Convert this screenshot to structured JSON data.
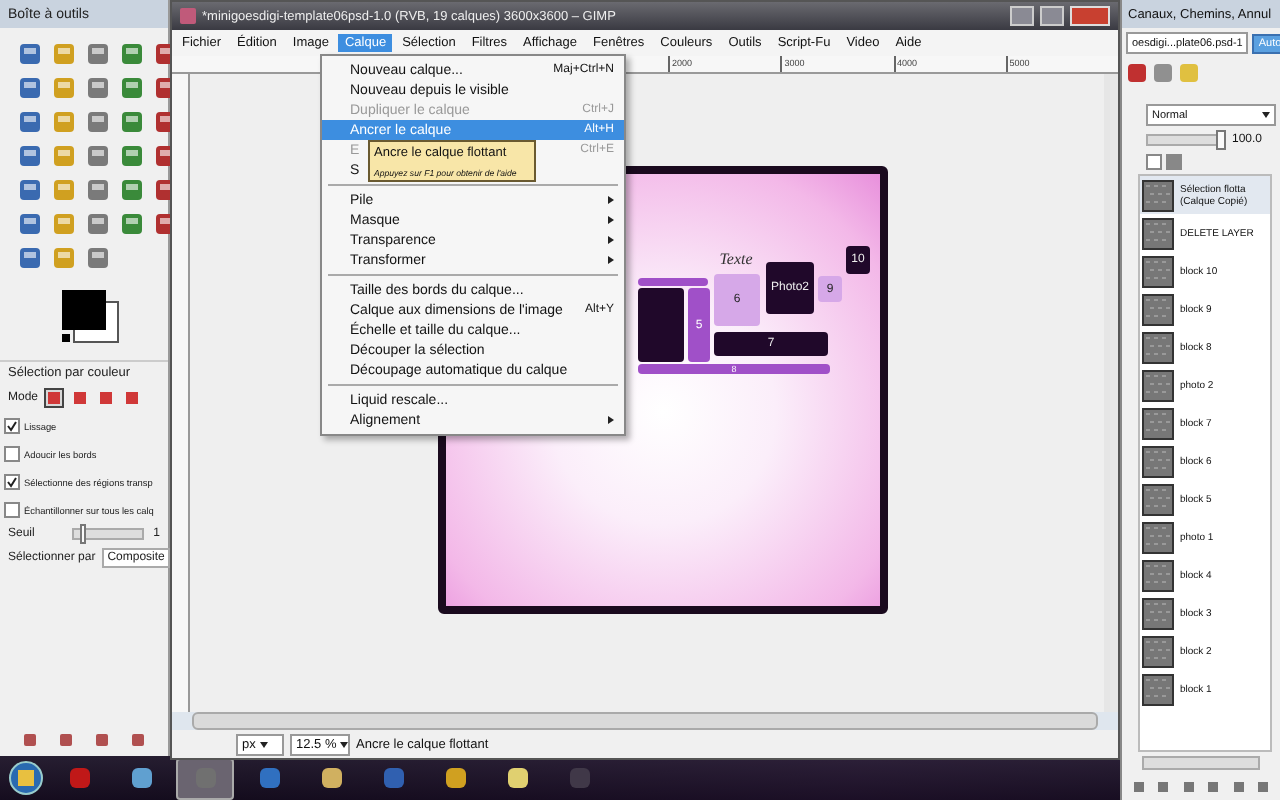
{
  "toolbox": {
    "title": "Boîte à outils",
    "tool_options": {
      "title": "Sélection par couleur",
      "mode_label": "Mode",
      "modes": [
        {
          "selected": true
        },
        {
          "selected": false
        },
        {
          "selected": false
        },
        {
          "selected": false
        }
      ],
      "options": [
        {
          "label": "Lissage",
          "checked": true
        },
        {
          "label": "Adoucir les bords",
          "checked": false
        },
        {
          "label": "Sélectionne des régions transp",
          "checked": true
        },
        {
          "label": "Échantillonner sur tous les calq",
          "checked": false
        }
      ],
      "threshold": {
        "label": "Seuil",
        "level": 0.1,
        "value": "1"
      },
      "select_by": {
        "label": "Sélectionner par",
        "value": "Composite"
      }
    }
  },
  "main_window": {
    "title": "*minigoesdigi-template06psd-1.0 (RVB, 19 calques) 3600x3600 – GIMP",
    "menu": [
      {
        "label": "Fichier",
        "selected": false
      },
      {
        "label": "Édition",
        "selected": false
      },
      {
        "label": "Image",
        "selected": false
      },
      {
        "label": "Calque",
        "selected": true
      },
      {
        "label": "Sélection",
        "selected": false
      },
      {
        "label": "Filtres",
        "selected": false
      },
      {
        "label": "Affichage",
        "selected": false
      },
      {
        "label": "Fenêtres",
        "selected": false
      },
      {
        "label": "Couleurs",
        "selected": false
      },
      {
        "label": "Outils",
        "selected": false
      },
      {
        "label": "Script-Fu",
        "selected": false
      },
      {
        "label": "Video",
        "selected": false
      },
      {
        "label": "Aide",
        "selected": false
      }
    ],
    "ruler_labels": [
      "2000",
      "3000",
      "4000",
      "5000"
    ],
    "canvas_blocks": [
      {
        "label": "Texte",
        "kind": "script"
      },
      {
        "label": "5",
        "kind": "mid"
      },
      {
        "label": "6",
        "kind": "light"
      },
      {
        "label": "Photo2",
        "kind": "dark"
      },
      {
        "label": "9",
        "kind": "light"
      },
      {
        "label": "10",
        "kind": "dark"
      },
      {
        "label": "7",
        "kind": "dark"
      },
      {
        "label": "8",
        "kind": "mid"
      }
    ],
    "status_bar": {
      "unit": "px",
      "zoom": "12.5 %",
      "message": "Ancre le calque flottant"
    }
  },
  "layer_menu": {
    "items": [
      {
        "kind": "item",
        "label": "Nouveau calque...",
        "shortcut": "Maj+Ctrl+N",
        "disabled": false,
        "selected": false
      },
      {
        "kind": "item",
        "label": "Nouveau depuis le visible",
        "disabled": false,
        "selected": false
      },
      {
        "kind": "item",
        "label": "Dupliquer le calque",
        "shortcut": "Ctrl+J",
        "disabled": true,
        "selected": false
      },
      {
        "kind": "item",
        "label": "Ancrer le calque",
        "shortcut": "Alt+H",
        "disabled": false,
        "selected": true
      },
      {
        "kind": "item",
        "label": "E",
        "shortcut": "Ctrl+E",
        "disabled": true,
        "selected": false
      },
      {
        "kind": "item",
        "label": "S",
        "disabled": false,
        "selected": false
      },
      {
        "kind": "separator"
      },
      {
        "kind": "submenu",
        "label": "Pile",
        "disabled": false,
        "selected": false
      },
      {
        "kind": "submenu",
        "label": "Masque",
        "disabled": false,
        "selected": false
      },
      {
        "kind": "submenu",
        "label": "Transparence",
        "disabled": false,
        "selected": false
      },
      {
        "kind": "submenu",
        "label": "Transformer",
        "disabled": false,
        "selected": false
      },
      {
        "kind": "separator"
      },
      {
        "kind": "item",
        "label": "Taille des bords du calque...",
        "disabled": false,
        "selected": false
      },
      {
        "kind": "item",
        "label": "Calque aux dimensions de l'image",
        "shortcut": "Alt+Y",
        "disabled": false,
        "selected": false
      },
      {
        "kind": "item",
        "label": "Échelle et taille du calque...",
        "disabled": false,
        "selected": false
      },
      {
        "kind": "item",
        "label": "Découper la sélection",
        "disabled": false,
        "selected": false
      },
      {
        "kind": "item",
        "label": "Découpage automatique du calque",
        "disabled": false,
        "selected": false
      },
      {
        "kind": "separator"
      },
      {
        "kind": "item",
        "label": "Liquid rescale...",
        "disabled": false,
        "selected": false
      },
      {
        "kind": "submenu",
        "label": "Alignement",
        "disabled": false,
        "selected": false
      }
    ],
    "tooltip": {
      "title": "Ancre le calque flottant",
      "hint": "Appuyez sur F1 pour obtenir de l'aide"
    }
  },
  "dock": {
    "title": "Canaux, Chemins, Annul",
    "image": "oesdigi...plate06.psd-1",
    "auto_button": "Auto",
    "mode": "Normal",
    "opacity": {
      "level": 1,
      "value": "100.0"
    },
    "lock_alpha": {
      "checked": false
    },
    "layers": [
      {
        "name": "Sélection flotta",
        "note": "(Calque Copié)",
        "selected": true
      },
      {
        "name": "DELETE LAYER",
        "selected": false
      },
      {
        "name": "block 10",
        "selected": false
      },
      {
        "name": "block 9",
        "selected": false
      },
      {
        "name": "block 8",
        "selected": false
      },
      {
        "name": "photo 2",
        "selected": false
      },
      {
        "name": "block 7",
        "selected": false
      },
      {
        "name": "block 6",
        "selected": false
      },
      {
        "name": "block 5",
        "selected": false
      },
      {
        "name": "photo 1",
        "selected": false
      },
      {
        "name": "block 4",
        "selected": false
      },
      {
        "name": "block 3",
        "selected": false
      },
      {
        "name": "block 2",
        "selected": false
      },
      {
        "name": "block 1",
        "selected": false
      }
    ]
  },
  "taskbar": {
    "apps": [
      {
        "selected": false
      },
      {
        "selected": false
      },
      {
        "selected": true
      },
      {
        "selected": false
      },
      {
        "selected": false
      },
      {
        "selected": false
      },
      {
        "selected": false
      },
      {
        "selected": false
      },
      {
        "selected": false
      }
    ]
  }
}
